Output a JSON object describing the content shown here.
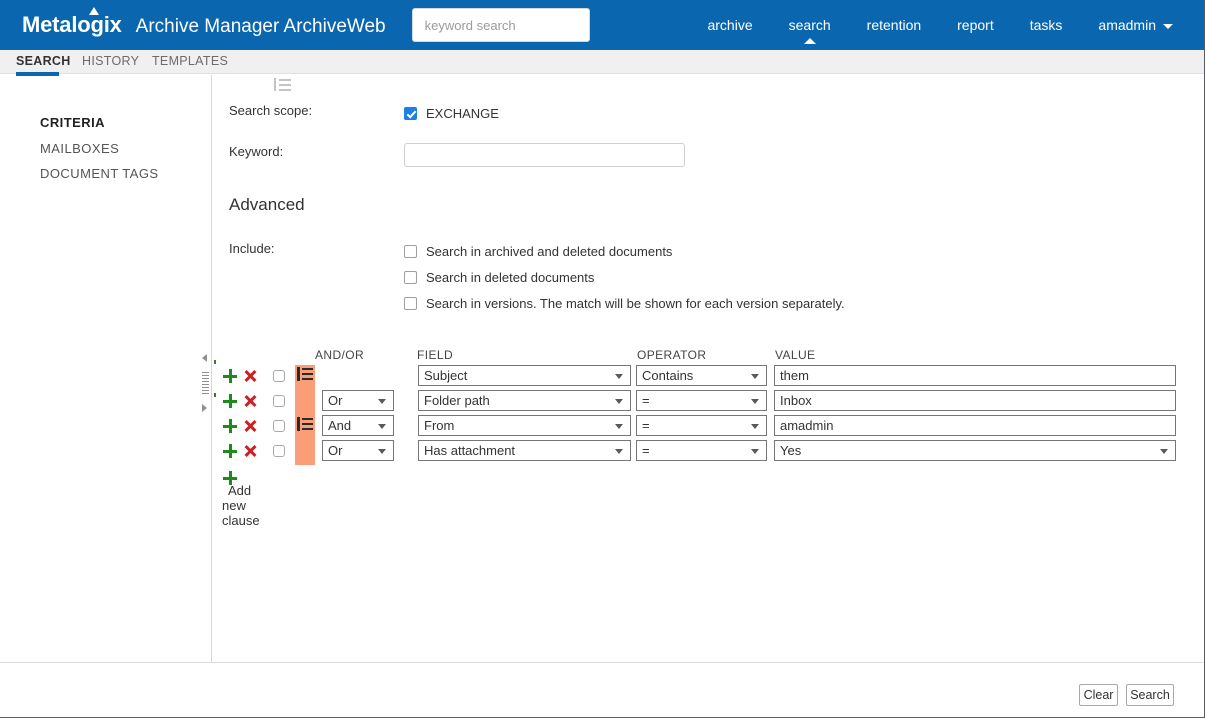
{
  "header": {
    "brand": "Metalogix",
    "app_title": "Archive Manager ArchiveWeb",
    "search_placeholder": "keyword search",
    "search_value": "",
    "nav": [
      {
        "label": "archive",
        "active": false
      },
      {
        "label": "search",
        "active": true
      },
      {
        "label": "retention",
        "active": false
      },
      {
        "label": "report",
        "active": false
      },
      {
        "label": "tasks",
        "active": false
      },
      {
        "label": "amadmin",
        "active": false,
        "has_caret": true
      }
    ]
  },
  "tabs": [
    {
      "label": "SEARCH",
      "active": true
    },
    {
      "label": "HISTORY",
      "active": false
    },
    {
      "label": "TEMPLATES",
      "active": false
    }
  ],
  "sidebar": {
    "items": [
      {
        "label": "CRITERIA",
        "active": true
      },
      {
        "label": "MAILBOXES",
        "active": false
      },
      {
        "label": "DOCUMENT TAGS",
        "active": false
      }
    ]
  },
  "main": {
    "scope_label": "Search scope:",
    "scope_option": "EXCHANGE",
    "scope_checked": true,
    "keyword_label": "Keyword:",
    "keyword_value": "",
    "advanced_heading": "Advanced",
    "include_label": "Include:",
    "include_options": [
      {
        "label": "Search in archived and deleted documents",
        "checked": false
      },
      {
        "label": "Search in deleted documents",
        "checked": false
      },
      {
        "label": "Search in versions. The match will be shown for each version separately.",
        "checked": false
      }
    ],
    "grid": {
      "columns": [
        "AND/OR",
        "FIELD",
        "OPERATOR",
        "VALUE"
      ],
      "rows": [
        {
          "selected": false,
          "group_start": true,
          "andor": "",
          "field": "Subject",
          "operator": "Contains",
          "value": "them",
          "value_type": "text"
        },
        {
          "selected": false,
          "group_start": false,
          "andor": "Or",
          "field": "Folder path",
          "operator": "=",
          "value": "Inbox",
          "value_type": "text"
        },
        {
          "selected": false,
          "group_start": true,
          "andor": "And",
          "field": "From",
          "operator": "=",
          "value": "amadmin",
          "value_type": "text"
        },
        {
          "selected": false,
          "group_start": false,
          "andor": "Or",
          "field": "Has attachment",
          "operator": "=",
          "value": "Yes",
          "value_type": "select"
        }
      ],
      "add_clause_label": "Add new clause"
    }
  },
  "footer": {
    "clear_label": "Clear",
    "search_label": "Search"
  },
  "colors": {
    "header_blue": "#0a66ae",
    "group_band": "#fb9d77",
    "checkbox_blue": "#1d7ee8",
    "plus_green": "#1e8a1e",
    "x_red": "#cc2026"
  }
}
